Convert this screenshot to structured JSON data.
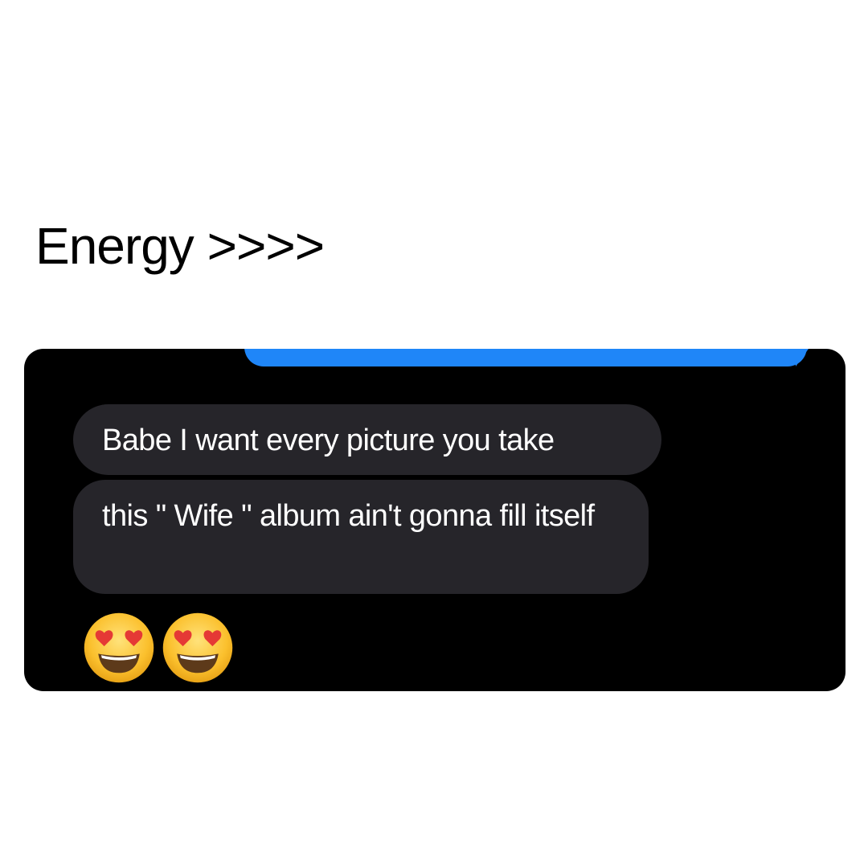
{
  "caption": {
    "text": "Energy >>>>"
  },
  "chat": {
    "messages": [
      {
        "direction": "received",
        "text": "Babe I want every picture you take"
      },
      {
        "direction": "received",
        "text": "this \" Wife \" album ain't gonna fill itself"
      }
    ],
    "reaction_emojis": [
      "heart-eyes-emoji",
      "heart-eyes-emoji"
    ]
  },
  "colors": {
    "page_background": "#ffffff",
    "chat_background": "#000000",
    "sent_bubble": "#1f86f8",
    "received_bubble": "#26252a",
    "received_text": "#ffffff",
    "caption_text": "#000000"
  }
}
